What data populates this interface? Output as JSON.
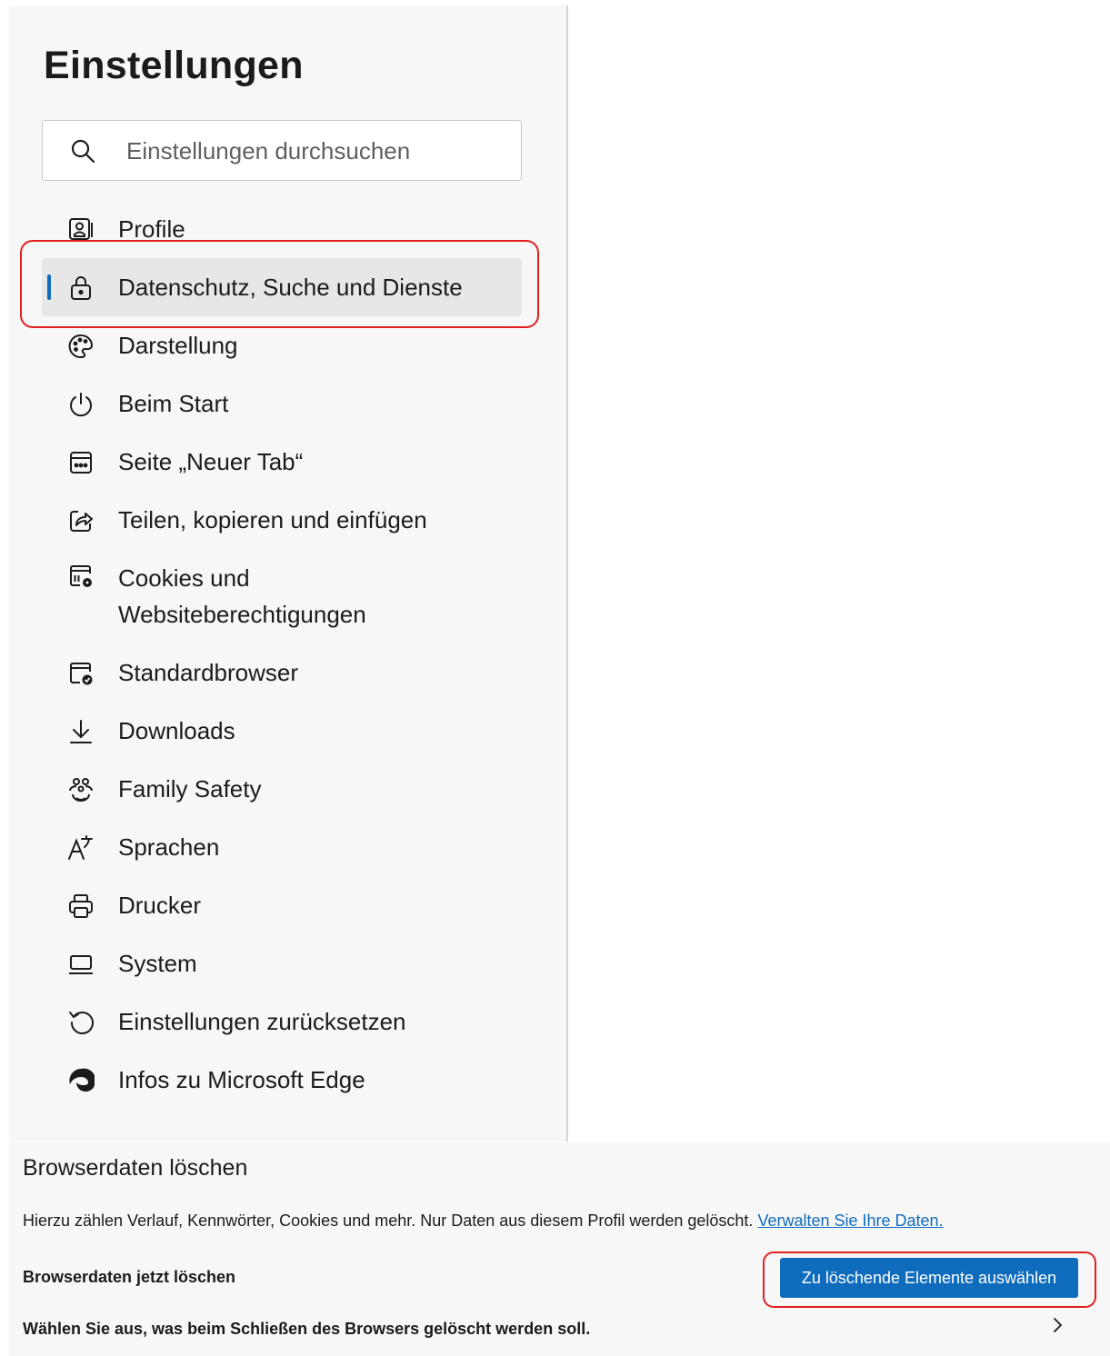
{
  "settings": {
    "title": "Einstellungen",
    "search_placeholder": "Einstellungen durchsuchen",
    "accent_color": "#0f6cbd",
    "highlight_color": "#e21f1f",
    "nav": [
      {
        "label": "Profile",
        "icon": "profile-icon"
      },
      {
        "label": "Datenschutz, Suche und Dienste",
        "icon": "lock-icon",
        "active": true
      },
      {
        "label": "Darstellung",
        "icon": "palette-icon"
      },
      {
        "label": "Beim Start",
        "icon": "power-icon"
      },
      {
        "label": "Seite „Neuer Tab“",
        "icon": "new-tab-icon"
      },
      {
        "label": "Teilen, kopieren und einfügen",
        "icon": "share-icon"
      },
      {
        "label": "Cookies und",
        "label_line2": "Websiteberechtigungen",
        "icon": "cookies-permissions-icon"
      },
      {
        "label": "Standardbrowser",
        "icon": "default-browser-icon"
      },
      {
        "label": "Downloads",
        "icon": "download-icon"
      },
      {
        "label": "Family Safety",
        "icon": "family-icon"
      },
      {
        "label": "Sprachen",
        "icon": "language-icon"
      },
      {
        "label": "Drucker",
        "icon": "printer-icon"
      },
      {
        "label": "System",
        "icon": "laptop-icon"
      },
      {
        "label": "Einstellungen zurücksetzen",
        "icon": "reset-icon"
      },
      {
        "label": "Infos zu Microsoft Edge",
        "icon": "edge-logo-icon"
      }
    ]
  },
  "clear_data": {
    "heading": "Browserdaten löschen",
    "description": "Hierzu zählen Verlauf, Kennwörter, Cookies und mehr. Nur Daten aus diesem Profil werden gelöscht.",
    "manage_link": "Verwalten Sie Ihre Daten.",
    "clear_now_label": "Browserdaten jetzt löschen",
    "choose_button": "Zu löschende Elemente auswählen",
    "on_close_label": "Wählen Sie aus, was beim Schließen des Browsers gelöscht werden soll."
  }
}
